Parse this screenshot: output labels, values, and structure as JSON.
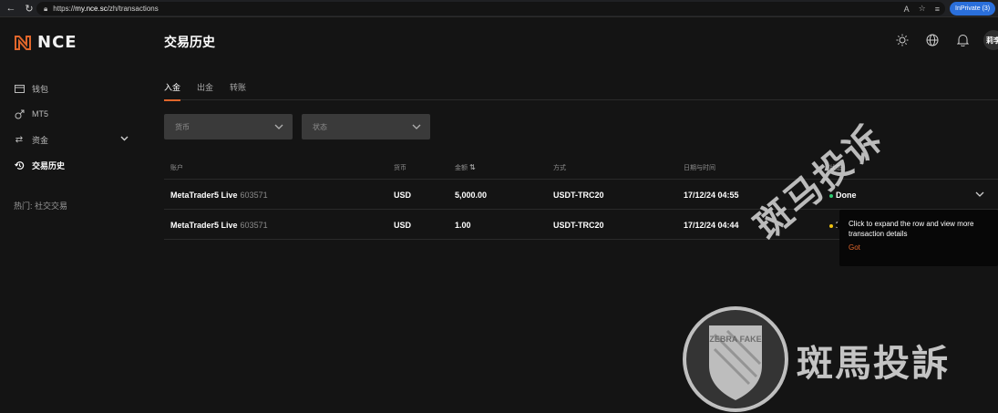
{
  "browser": {
    "url_prefix": "https://",
    "url_host": "my.nce.sc",
    "url_path": "/zh/transactions",
    "inprivate_label": "InPrivate (3)"
  },
  "brand": {
    "name": "NCE",
    "accent_color": "#e0662b"
  },
  "sidebar": {
    "items": [
      {
        "label": "钱包",
        "icon": "wallet-icon"
      },
      {
        "label": "MT5",
        "icon": "gender-icon"
      },
      {
        "label": "资金",
        "icon": "transfer-arrows-icon"
      },
      {
        "label": "交易历史",
        "icon": "history-icon"
      }
    ],
    "hot_text": "热门: 社交交易"
  },
  "header": {
    "title": "交易历史",
    "avatar_text": "莉李"
  },
  "tabs": [
    {
      "label": "入金",
      "active": true
    },
    {
      "label": "出金",
      "active": false
    },
    {
      "label": "转账",
      "active": false
    }
  ],
  "filters": {
    "currency_placeholder": "货币",
    "status_placeholder": "状态"
  },
  "table": {
    "headers": {
      "account": "账户",
      "currency": "货币",
      "amount": "金额",
      "method": "方式",
      "datetime": "日期与时间",
      "status": "状态"
    },
    "rows": [
      {
        "account": "MetaTrader5 Live",
        "account_id": "603571",
        "currency": "USD",
        "amount": "5,000.00",
        "method": "USDT-TRC20",
        "datetime": "17/12/24 04:55",
        "status": "Done",
        "status_color": "#2ecc71"
      },
      {
        "account": "MetaTrader5 Live",
        "account_id": "603571",
        "currency": "USD",
        "amount": "1.00",
        "method": "USDT-TRC20",
        "datetime": "17/12/24 04:44",
        "status": "F",
        "status_color": "#f1c40f"
      }
    ]
  },
  "tooltip": {
    "text": "Click to expand the row and view more transaction details",
    "button": "Got"
  },
  "watermark": {
    "text": "斑馬投訴",
    "diag_text": "斑马投诉",
    "badge": "ZEBRA FAKE"
  }
}
